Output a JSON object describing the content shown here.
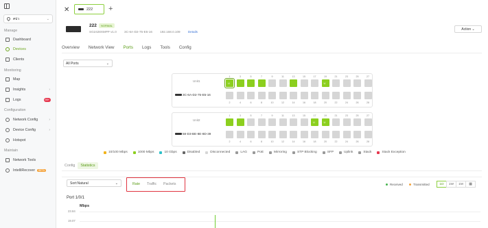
{
  "sidebar": {
    "site_name": "ศปว",
    "sections": {
      "manage": "Manage",
      "monitoring": "Monitoring",
      "configuration": "Configuration",
      "maintain": "Maintain"
    },
    "items": {
      "dashboard": "Dashboard",
      "devices": "Devices",
      "clients": "Clients",
      "map": "Map",
      "insights": "Insights",
      "logs": "Logs",
      "logs_badge": "99+",
      "network_config": "Network Config",
      "device_config": "Device Config",
      "hotspot": "Hotspot",
      "network_tools": "Network Tools",
      "intellirecover": "IntelliRecover",
      "beta": "BETA"
    }
  },
  "topbar": {
    "tab_label": "222",
    "close_glyph": "✕",
    "add_glyph": "+"
  },
  "device": {
    "name": "222",
    "status": "NORMAL",
    "model": "SG2428XMPP v1.0",
    "mac": "3C-6A-D2-75-E5-16",
    "ip": "192.168.0.109",
    "details_link": "Details",
    "action_label": "Action"
  },
  "tabs": [
    "Overview",
    "Network View",
    "Ports",
    "Logs",
    "Tools",
    "Config"
  ],
  "active_tab": "Ports",
  "ports_filter": "All Ports",
  "units": [
    {
      "label": "Unit1",
      "device_mac": "3C-6A-D2-75-E5-16",
      "top_numbers": [
        "1",
        "3",
        "5",
        "7",
        "9",
        "11",
        "13",
        "15",
        "17",
        "19",
        "21",
        "23",
        "25",
        "27"
      ],
      "bottom_numbers": [
        "2",
        "4",
        "6",
        "8",
        "10",
        "12",
        "14",
        "16",
        "18",
        "20",
        "22",
        "24",
        "26",
        "28"
      ],
      "top_on": [
        true,
        true,
        true,
        true,
        false,
        false,
        true,
        false,
        false,
        true,
        false,
        false,
        false,
        false
      ],
      "bottom_on": [
        false,
        false,
        false,
        false,
        false,
        false,
        false,
        false,
        false,
        false,
        false,
        false,
        false,
        false
      ],
      "top_glyphs": [
        "U",
        "",
        "",
        "",
        "",
        "",
        "",
        "",
        "",
        "U",
        "",
        "",
        "",
        ""
      ]
    },
    {
      "label": "Unit2",
      "device_mac": "58-D3-BE-8E-8D-39",
      "top_numbers": [
        "1",
        "3",
        "5",
        "7",
        "9",
        "11",
        "13",
        "15",
        "17",
        "19",
        "21",
        "23",
        "25",
        "27"
      ],
      "bottom_numbers": [
        "2",
        "4",
        "6",
        "8",
        "10",
        "12",
        "14",
        "16",
        "18",
        "20",
        "22",
        "24",
        "26",
        "28"
      ],
      "top_on": [
        true,
        true,
        false,
        false,
        false,
        false,
        false,
        false,
        true,
        true,
        false,
        false,
        false,
        false
      ],
      "bottom_on": [
        false,
        false,
        false,
        false,
        false,
        false,
        false,
        false,
        false,
        false,
        false,
        false,
        false,
        false
      ],
      "top_glyphs": [
        "",
        "",
        "",
        "",
        "",
        "",
        "",
        "",
        "U",
        "U",
        "",
        "",
        "",
        ""
      ]
    }
  ],
  "legend": [
    {
      "label": "10/100 Mbps",
      "color": "#f2b31b"
    },
    {
      "label": "1000 Mbps",
      "color": "#8ccf1f"
    },
    {
      "label": "10 Gbps",
      "color": "#2ec1c9"
    },
    {
      "label": "Disabled",
      "color": "#666666"
    },
    {
      "label": "Disconnected",
      "color": "#d6d6d6"
    },
    {
      "label": "LAG",
      "color": "#999999"
    },
    {
      "label": "PoE",
      "color": "#999999"
    },
    {
      "label": "Mirroring",
      "color": "#999999"
    },
    {
      "label": "STP Blocking",
      "color": "#999999"
    },
    {
      "label": "SFP",
      "color": "#999999"
    },
    {
      "label": "Uplink",
      "color": "#999999"
    },
    {
      "label": "Stack",
      "color": "#999999"
    },
    {
      "label": "Stack Exception",
      "color": "#e6384f"
    }
  ],
  "subtabs": [
    "Config",
    "Statistics"
  ],
  "stats": {
    "sort_label": "Sort:Natural",
    "metrics": [
      "Rate",
      "Traffic",
      "Packets"
    ],
    "received": "Received",
    "transmitted": "Transmitted",
    "ranges": [
      "1D",
      "1W",
      "1M",
      "▦"
    ],
    "port_title": "Port 1/0/1",
    "unit": "Mbps",
    "y_ticks": [
      "23.84",
      "19.07"
    ],
    "received_color": "#45b34d",
    "transmitted_color": "#f4a23a"
  }
}
